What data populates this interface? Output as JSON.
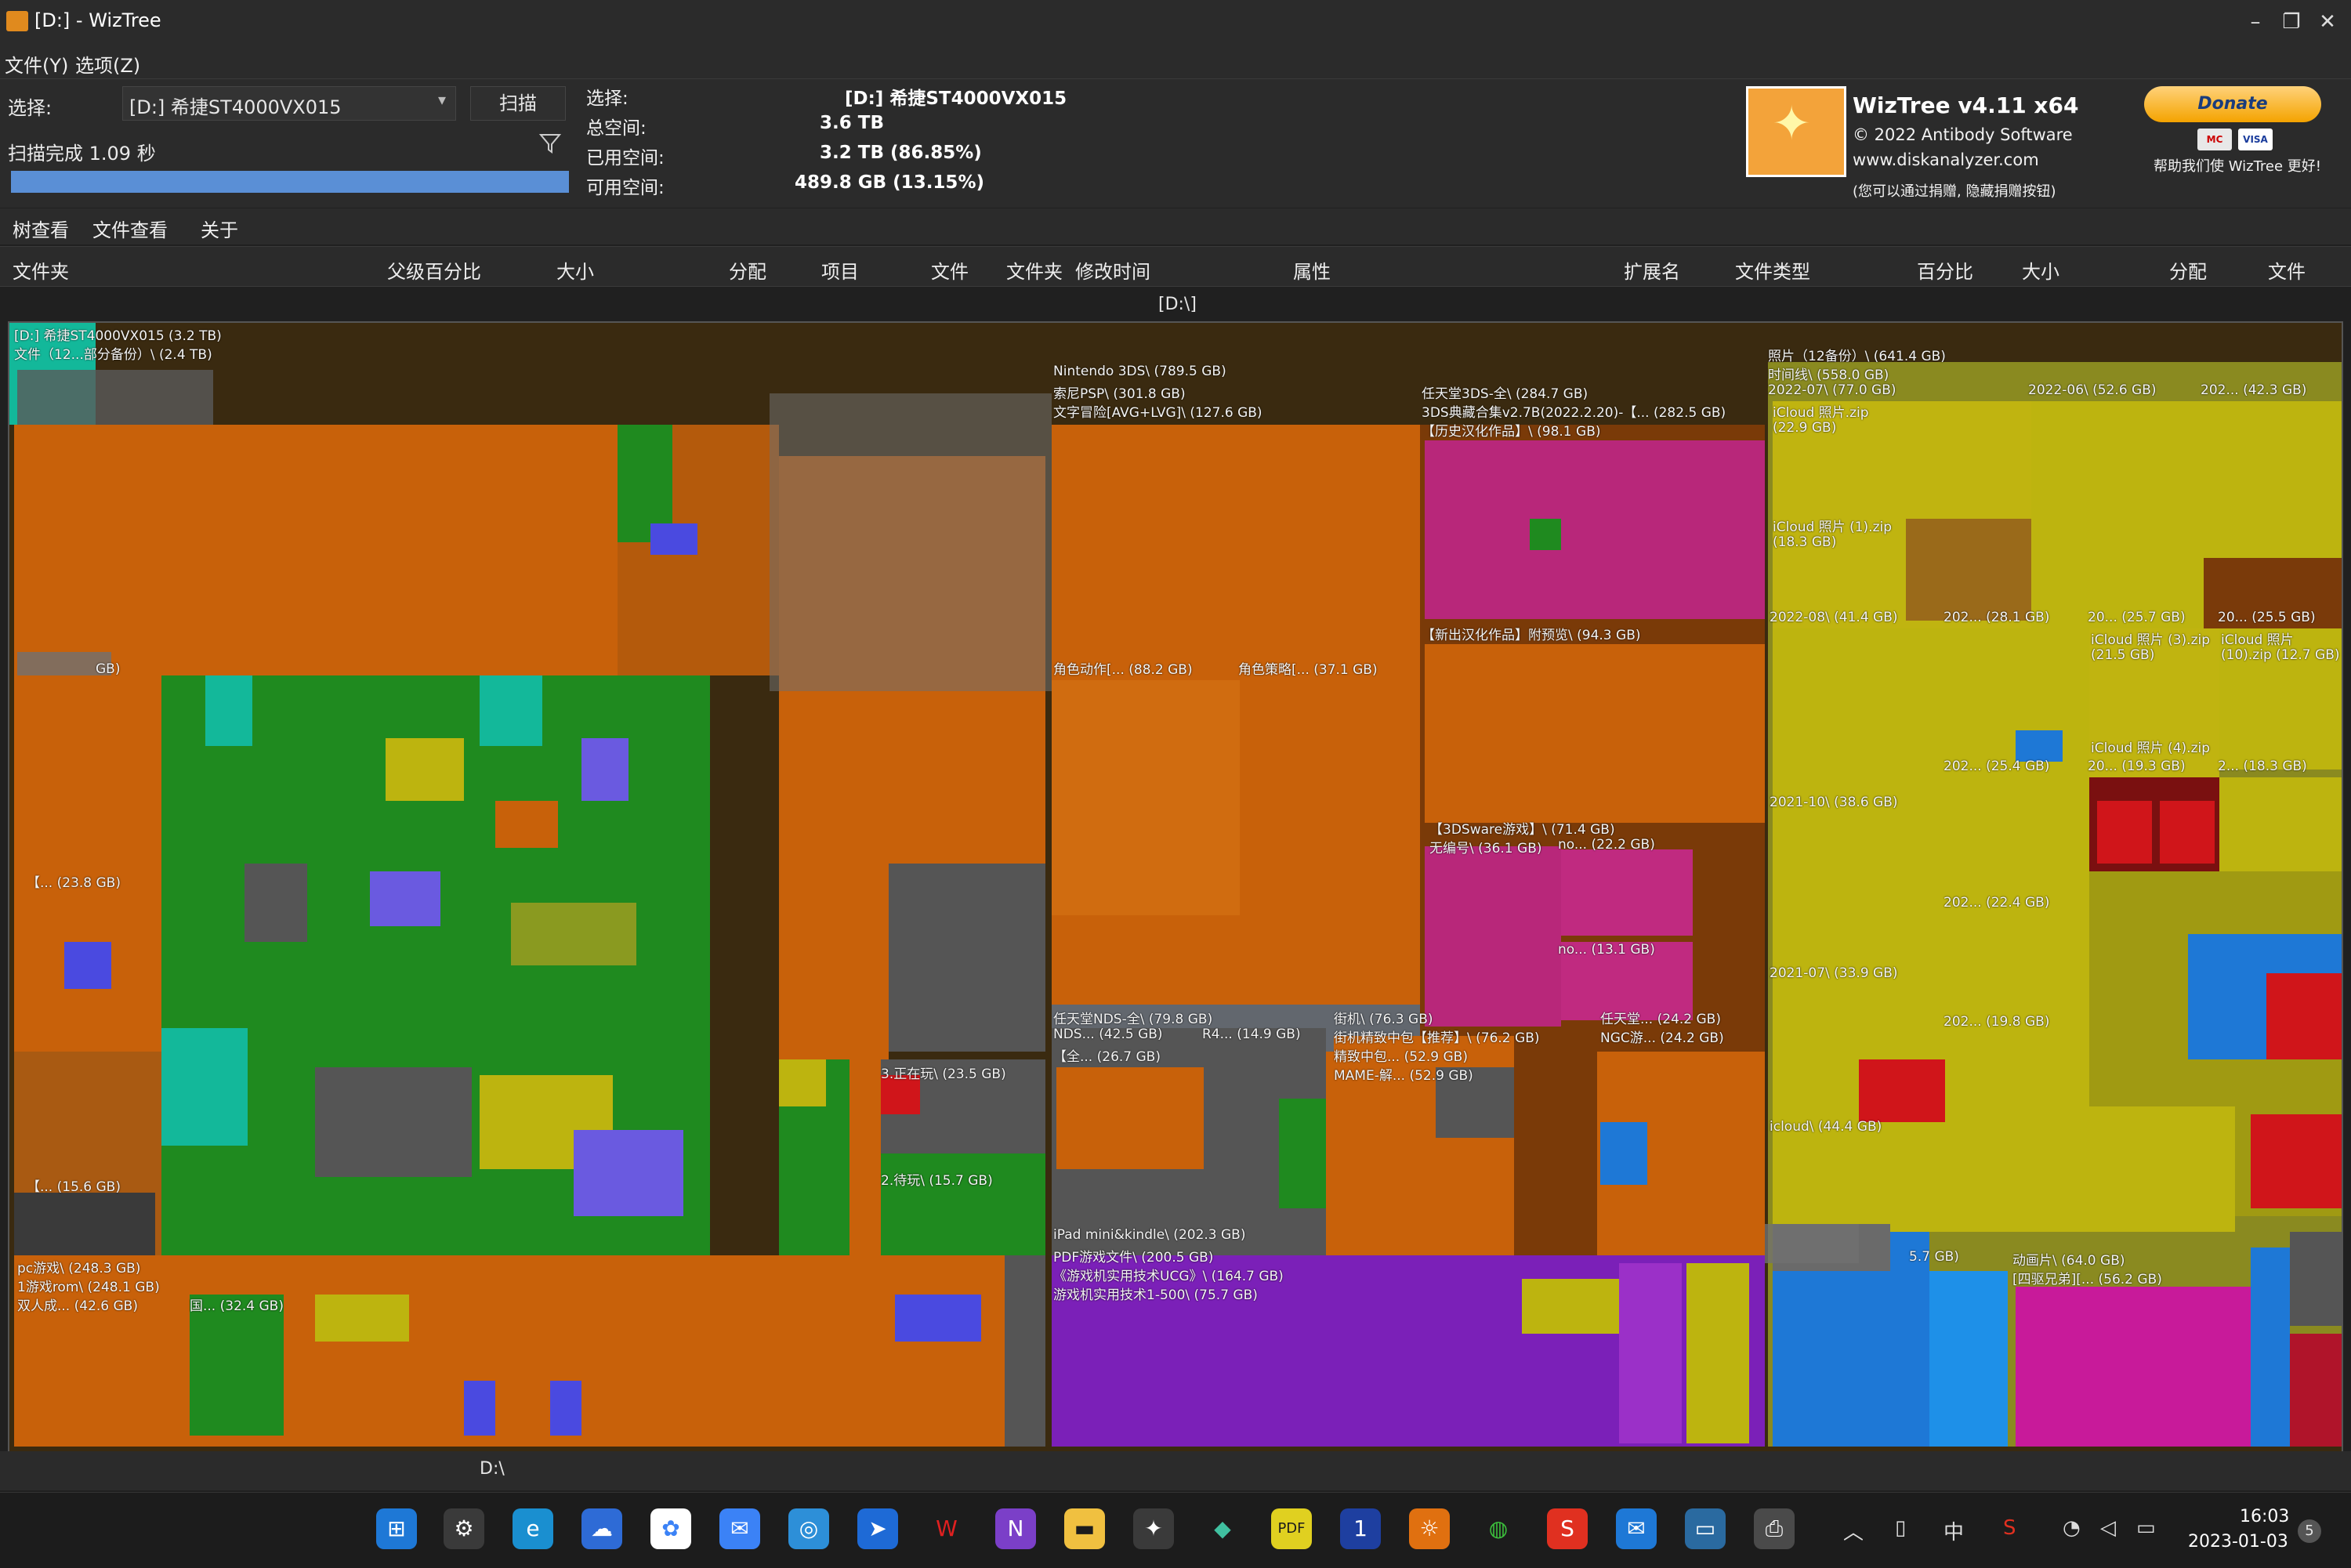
{
  "window": {
    "title": "[D:]  - WizTree"
  },
  "menu": [
    "文件(Y)",
    "选项(Z)"
  ],
  "scan": {
    "select_label": "选择:",
    "drive_value": "[D:] 希捷ST4000VX015",
    "scan_button": "扫描",
    "status": "扫描完成 1.09 秒",
    "progress_fraction": 1.0
  },
  "drive_info": {
    "select_label": "选择:",
    "select_value": "[D:]   希捷ST4000VX015",
    "total_label": "总空间:",
    "total_value": "3.6 TB",
    "used_label": "已用空间:",
    "used_value": "3.2 TB  (86.85%)",
    "free_label": "可用空间:",
    "free_value": "489.8 GB  (13.15%)"
  },
  "about": {
    "product": "WizTree v4.11 x64",
    "copyright": "© 2022 Antibody Software",
    "website": "www.diskanalyzer.com",
    "note": "(您可以通过捐赠, 隐藏捐赠按钮)",
    "donate_label": "Donate",
    "donate_note": "帮助我们使 WizTree 更好!",
    "card1": "MC",
    "card2": "VISA"
  },
  "tabs": [
    "树查看",
    "文件查看",
    "关于"
  ],
  "columns_left": [
    "文件夹",
    "父级百分比",
    "大小",
    "分配",
    "项目",
    "文件",
    "文件夹",
    "修改时间",
    "属性"
  ],
  "columns_right": [
    "扩展名",
    "文件类型",
    "百分比",
    "大小",
    "分配",
    "文件"
  ],
  "path_top": "[D:\\]",
  "path_bottom": "D:\\",
  "treemap_labels": {
    "root": "[D:] 希捷ST4000VX015  (3.2 TB)",
    "sub1": "文件（12...部分备份）\\  (2.4 TB)",
    "gb": "GB)",
    "l238": "【... (23.8 GB)",
    "l156": "【... (15.6 GB)",
    "nintendo": "Nintendo 3DS\\ (789.5 GB)",
    "psp": "索尼PSP\\ (301.8 GB)",
    "avg": "文字冒险[AVG+LVG]\\ (127.6 GB)",
    "act": "角色动作[... (88.2 GB)",
    "strat": "角色策略[... (37.1 GB)",
    "3ds_all": "任天堂3DS-全\\ (284.7 GB)",
    "3ds_classic": "3DS典藏合集v2.7B(2022.2.20)-【... (282.5 GB)",
    "hist": "【历史汉化作品】\\ (98.1 GB)",
    "new": "【新出汉化作品】附预览\\ (94.3 GB)",
    "ware": "【3DSware游戏】\\ (71.4 GB)",
    "nonum": "无编号\\ (36.1 GB)",
    "no222": "no... (22.2 GB)",
    "no131": "no... (13.1 GB)",
    "playing": "3.正在玩\\ (23.5 GB)",
    "toplay": "2.待玩\\ (15.7 GB)",
    "nds_all": "任天堂NDS-全\\ (79.8 GB)",
    "nds": "NDS... (42.5 GB)",
    "r4": "R4... (14.9 GB)",
    "full": "【全... (26.7 GB)",
    "arcade": "街机\\ (76.3 GB)",
    "arcade_sel": "街机精致中包【推荐】\\ (76.2 GB)",
    "arcade_mid": "精致中包... (52.9 GB)",
    "mame": "MAME-解... (52.9 GB)",
    "nin2": "任天堂... (24.2 GB)",
    "ngc": "NGC游... (24.2 GB)",
    "pc": "pc游戏\\ (248.3 GB)",
    "rom": "1游戏rom\\ (248.1 GB)",
    "adult": "双人成... (42.6 GB)",
    "guo": "国... (32.4 GB)",
    "ipad": "iPad mini&kindle\\ (202.3 GB)",
    "pdf": "PDF游戏文件\\ (200.5 GB)",
    "ucg": "《游戏机实用技术UCG》\\ (164.7 GB)",
    "ucg2": "游戏机实用技术1-500\\ (75.7 GB)",
    "photos": "照片（12备份）\\ (641.4 GB)",
    "timeline": "时间线\\ (558.0 GB)",
    "m07": "2022-07\\ (77.0 GB)",
    "m06": "2022-06\\ (52.6 GB)",
    "m202": "202... (42.3 GB)",
    "icloud_zip": "iCloud 照片.zip",
    "icloud_zip_sz": "(22.9 GB)",
    "icloud1": "iCloud 照片 (1).zip",
    "icloud1_sz": "(18.3 GB)",
    "m08": "2022-08\\ (41.4 GB)",
    "c281": "202... (28.1 GB)",
    "c257": "20... (25.7 GB)",
    "c255": "20... (25.5 GB)",
    "icloud3": "iCloud 照片 (3).zip",
    "icloud3_sz": "(21.5 GB)",
    "icloud10": "iCloud 照片",
    "icloud10_sz": "(10).zip (12.7 GB)",
    "icloud4": "iCloud 照片 (4).zip",
    "c254": "202... (25.4 GB)",
    "c193": "20... (19.3 GB)",
    "c183": "2... (18.3 GB)",
    "m10": "2021-10\\ (38.6 GB)",
    "c224": "202... (22.4 GB)",
    "m0721": "2021-07\\ (33.9 GB)",
    "c198": "202... (19.8 GB)",
    "icloud_dir": "icloud\\ (44.4 GB)",
    "g57": "5.7 GB)",
    "anime": "动画片\\ (64.0 GB)",
    "siblings": "[四驱兄弟][... (56.2 GB)"
  },
  "taskbar": {
    "time": "16:03",
    "date": "2023-01-03",
    "ime": "中",
    "notif_count": "5"
  },
  "colors": {
    "orange": "#c8610a",
    "green": "#1f8a1f",
    "yellow": "#bdb40f",
    "magenta": "#b8277a",
    "purple": "#7b20b8",
    "blue": "#1e78d6",
    "red": "#d0151a"
  }
}
